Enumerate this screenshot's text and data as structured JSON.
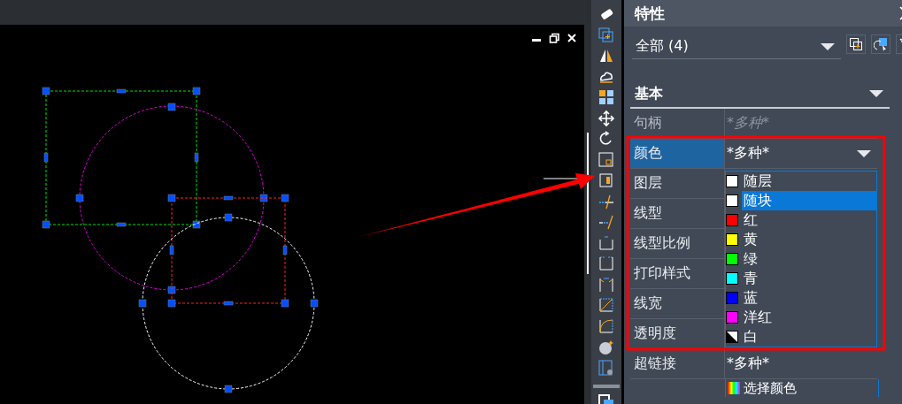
{
  "panel": {
    "title": "特性"
  },
  "selection": {
    "value": "全部 (4)"
  },
  "section": {
    "title": "基本",
    "expanded": true
  },
  "properties": [
    {
      "label": "句柄",
      "value": "*多种*",
      "disabled": true,
      "selected": false
    },
    {
      "label": "颜色",
      "value": "*多种*",
      "disabled": false,
      "selected": true
    },
    {
      "label": "图层",
      "disabled": false,
      "selected": false
    },
    {
      "label": "线型",
      "disabled": false,
      "selected": false
    },
    {
      "label": "线型比例",
      "disabled": false,
      "selected": false
    },
    {
      "label": "打印样式",
      "disabled": false,
      "selected": false
    },
    {
      "label": "线宽",
      "disabled": false,
      "selected": false
    },
    {
      "label": "透明度",
      "disabled": false,
      "selected": false
    },
    {
      "label": "超链接",
      "value": "*多种*",
      "disabled": false,
      "selected": false
    }
  ],
  "color_list": [
    {
      "name": "随层",
      "kind": "swatch",
      "color": "#ffffff",
      "selected": false
    },
    {
      "name": "随块",
      "kind": "swatch",
      "color": "#ffffff",
      "selected": true
    },
    {
      "name": "红",
      "kind": "swatch",
      "color": "#ff0000",
      "selected": false
    },
    {
      "name": "黄",
      "kind": "swatch",
      "color": "#ffff00",
      "selected": false
    },
    {
      "name": "绿",
      "kind": "swatch",
      "color": "#00ff00",
      "selected": false
    },
    {
      "name": "青",
      "kind": "swatch",
      "color": "#00ffff",
      "selected": false
    },
    {
      "name": "蓝",
      "kind": "swatch",
      "color": "#0000ff",
      "selected": false
    },
    {
      "name": "洋红",
      "kind": "swatch",
      "color": "#ff00ff",
      "selected": false
    },
    {
      "name": "白",
      "kind": "split",
      "selected": false
    }
  ],
  "more_colors": {
    "label": "选择颜色"
  }
}
